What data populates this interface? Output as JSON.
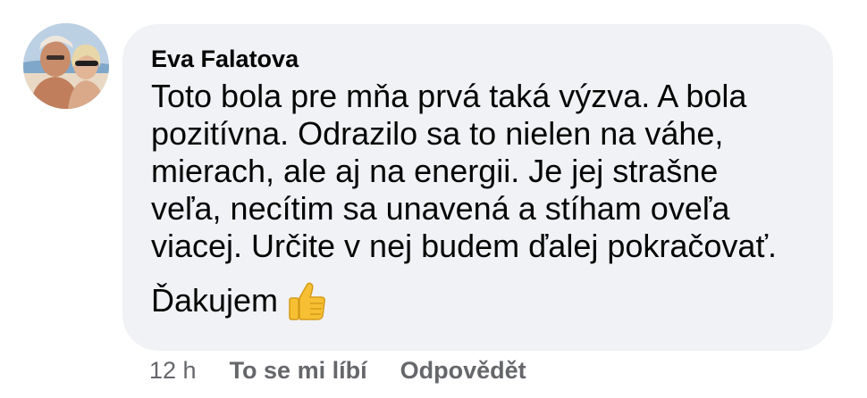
{
  "comment": {
    "author": "Eva Falatova",
    "lines": [
      "Toto bola pre mňa prvá taká výzva. A bola",
      "pozitívna. Odrazilo sa to nielen na váhe,",
      "mierach, ale aj na energii. Je jej strašne",
      "veľa, necítim sa unavená a stíham oveľa",
      "viacej. Určite v nej budem ďalej pokračovať."
    ],
    "closing": "Ďakujem",
    "closing_emoji": "thumbs-up-icon"
  },
  "actions": {
    "timestamp": "12 h",
    "like_label": "To se mi líbí",
    "reply_label": "Odpovědět"
  },
  "colors": {
    "bubble": "#f0f2f5",
    "text": "#050505",
    "secondary": "#65676b"
  }
}
